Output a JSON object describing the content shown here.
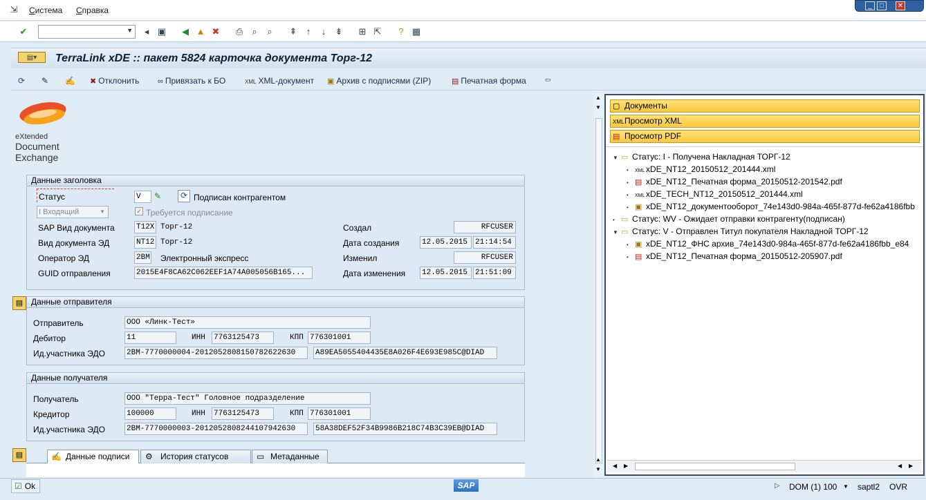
{
  "menu": {
    "system": "Система",
    "help": "Справка"
  },
  "window_controls": {
    "minimize": "_",
    "restore": "□",
    "close": "✕"
  },
  "title": "TerraLink xDE :: пакет 5824 карточка документа Торг-12",
  "app_buttons": {
    "reject": "Отклонить",
    "bind": "Привязать к БО",
    "xml": "XML-документ",
    "archive": "Архив с подписями (ZIP)",
    "print": "Печатная форма"
  },
  "logo": {
    "line1": "eXtended",
    "line2": "Document",
    "line3": "Exchange"
  },
  "header_group": {
    "title": "Данные заголовка",
    "status_label": "Статус",
    "status_value": "V",
    "status_text": "Подписан контрагентом",
    "direction_value": "I Входящий",
    "sign_required": "Требуется подписание",
    "sap_doc_type_label": "SAP Вид документа",
    "sap_doc_type_code": "T12X",
    "sap_doc_type_text": "Торг-12",
    "ed_type_label": "Вид документа ЭД",
    "ed_type_code": "NT12",
    "ed_type_text": "Торг-12",
    "operator_label": "Оператор ЭД",
    "operator_code": "2BM",
    "operator_text": "Электронный экспресс",
    "guid_label": "GUID отправления",
    "guid_value": "2015E4F8CA62C062EEF1A74A005056B165...",
    "created_by_label": "Создал",
    "created_by": "RFCUSER",
    "created_date_label": "Дата создания",
    "created_date": "12.05.2015",
    "created_time": "21:14:54",
    "changed_by_label": "Изменил",
    "changed_by": "RFCUSER",
    "changed_date_label": "Дата изменения",
    "changed_date": "12.05.2015",
    "changed_time": "21:51:09"
  },
  "sender_group": {
    "title": "Данные отправителя",
    "sender_label": "Отправитель",
    "sender_value": "ООО «Линк-Тест»",
    "debtor_label": "Дебитор",
    "debtor_value": "11",
    "inn_label": "ИНН",
    "inn_value": "7763125473",
    "kpp_label": "КПП",
    "kpp_value": "776301001",
    "edo_label": "Ид.участника ЭДО",
    "edo_value": "2BM-7770000004-2012052808150782622630",
    "edo_box": "A89EA5055404435E8A026F4E693E985C@DIAD"
  },
  "receiver_group": {
    "title": "Данные получателя",
    "receiver_label": "Получатель",
    "receiver_value": "ООО \"Терра-Тест\" Головное подразделение",
    "creditor_label": "Кредитор",
    "creditor_value": "100000",
    "inn_label": "ИНН",
    "inn_value": "7763125473",
    "kpp_label": "КПП",
    "kpp_value": "776301001",
    "edo_label": "Ид.участника ЭДО",
    "edo_value": "2BM-7770000003-2012052808244107942630",
    "edo_box": "58A38DEF52F34B9986B218C74B3C39EB@DIAD"
  },
  "tabs": [
    "Данные подписи",
    "История статусов",
    "Метаданные"
  ],
  "right_buttons": [
    "Документы",
    "Просмотр XML",
    "Просмотр PDF"
  ],
  "tree": [
    {
      "text": "Статус: I - Получена Накладная ТОРГ-12"
    },
    {
      "text": "xDE_NT12_20150512_201444.xml"
    },
    {
      "text": "xDE_NT12_Печатная форма_20150512-201542.pdf"
    },
    {
      "text": "xDE_TECH_NT12_20150512_201444.xml"
    },
    {
      "text": "xDE_NT12_документооборот_74e143d0-984a-465f-877d-fe62a4186fbb"
    },
    {
      "text": "Статус: WV - Ожидает отправки контрагенту(подписан)"
    },
    {
      "text": "Статус: V - Отправлен Титул покупателя Накладной ТОРГ-12"
    },
    {
      "text": "xDE_NT12_ФНС архив_74e143d0-984a-465f-877d-fe62a4186fbb_e84"
    },
    {
      "text": "xDE_NT12_Печатная форма_20150512-205907.pdf"
    }
  ],
  "status": {
    "ok": "Ok",
    "sap": "SAP",
    "system": "DOM (1) 100",
    "server": "saptl2",
    "mode": "OVR"
  }
}
